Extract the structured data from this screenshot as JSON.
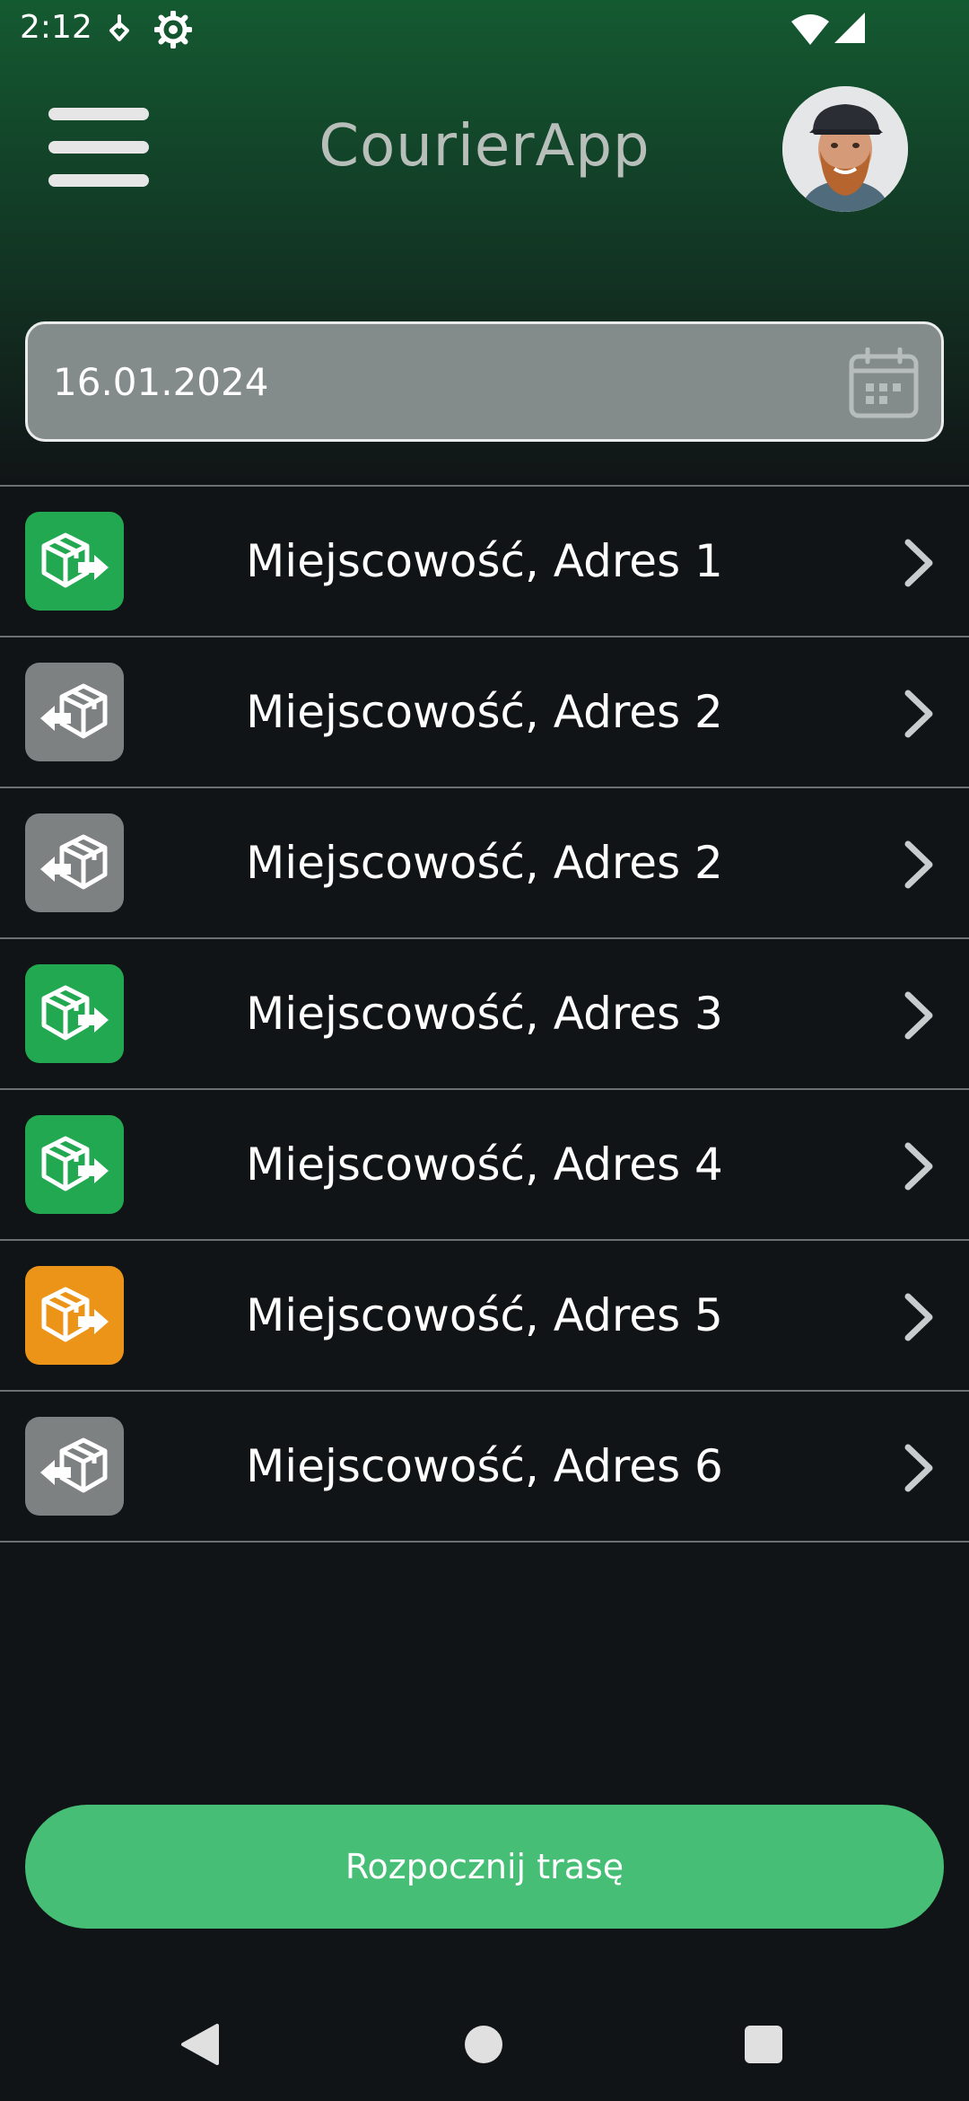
{
  "status_bar": {
    "time": "2:12"
  },
  "header": {
    "title": "CourierApp"
  },
  "date_field": {
    "value": "16.01.2024"
  },
  "deliveries": [
    {
      "label": "Miejscowość, Adres 1",
      "icon": "package-out-icon",
      "color": "#22a850"
    },
    {
      "label": "Miejscowość, Adres 2",
      "icon": "package-return-icon",
      "color": "#7e8181"
    },
    {
      "label": "Miejscowość, Adres 2",
      "icon": "package-return-icon",
      "color": "#7e8181"
    },
    {
      "label": "Miejscowość, Adres 3",
      "icon": "package-out-icon",
      "color": "#22a850"
    },
    {
      "label": "Miejscowość, Adres 4",
      "icon": "package-out-icon",
      "color": "#22a850"
    },
    {
      "label": "Miejscowość, Adres 5",
      "icon": "package-out-icon",
      "color": "#ec9418"
    },
    {
      "label": "Miejscowość, Adres 6",
      "icon": "package-return-icon",
      "color": "#7e8181"
    }
  ],
  "start_button": {
    "label": "Rozpocznij trasę"
  }
}
